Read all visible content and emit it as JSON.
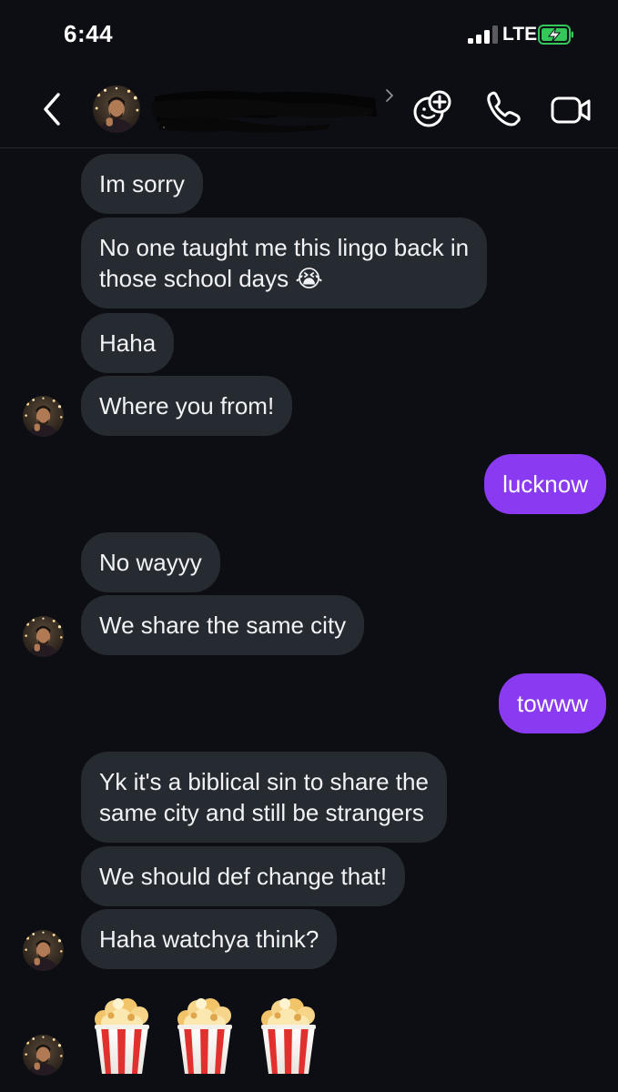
{
  "status_bar": {
    "time": "6:44",
    "network": "LTE",
    "signal_bars": 3,
    "battery_charging": true,
    "battery_color": "#34c759"
  },
  "header": {
    "back_icon": "chevron-left-icon",
    "contact_name_redacted": true,
    "chevron_icon": "chevron-right-icon",
    "actions": [
      {
        "name": "effects",
        "icon": "smiley-plus-icon"
      },
      {
        "name": "call",
        "icon": "phone-icon"
      },
      {
        "name": "video",
        "icon": "video-camera-icon"
      }
    ]
  },
  "colors": {
    "background": "#0c0e14",
    "incoming_bubble": "#262a31",
    "outgoing_bubble": "#8a3af0"
  },
  "messages": [
    {
      "direction": "incoming",
      "text": "Im sorry"
    },
    {
      "direction": "incoming",
      "text": "No one taught me this lingo back in\nthose school days 😭"
    },
    {
      "direction": "incoming",
      "text": "Haha"
    },
    {
      "direction": "incoming",
      "text": "Where you from!"
    },
    {
      "direction": "outgoing",
      "text": "lucknow"
    },
    {
      "direction": "incoming",
      "text": "No wayyy"
    },
    {
      "direction": "incoming",
      "text": "We share the same city"
    },
    {
      "direction": "outgoing",
      "text": "towww"
    },
    {
      "direction": "incoming",
      "text": "Yk it's a biblical sin to share the\nsame city and still be strangers"
    },
    {
      "direction": "incoming",
      "text": "We should def change that!"
    },
    {
      "direction": "incoming",
      "text": "Haha watchya think?"
    },
    {
      "direction": "incoming",
      "emoji_icons": [
        "popcorn-icon",
        "popcorn-icon",
        "popcorn-icon"
      ]
    }
  ]
}
